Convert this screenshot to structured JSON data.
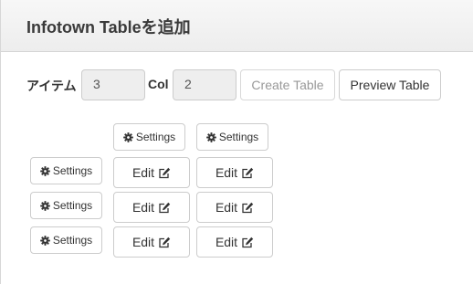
{
  "dialog": {
    "title": "Infotown Tableを追加"
  },
  "form": {
    "item_label": "アイテム",
    "item_value": "3",
    "col_label": "Col",
    "col_value": "2",
    "create_button": "Create Table",
    "preview_button": "Preview Table"
  },
  "table": {
    "settings_label": "Settings",
    "edit_label": "Edit",
    "columns": 2,
    "rows": 3
  },
  "icons": {
    "settings": "gear-icon",
    "edit": "edit-icon"
  }
}
